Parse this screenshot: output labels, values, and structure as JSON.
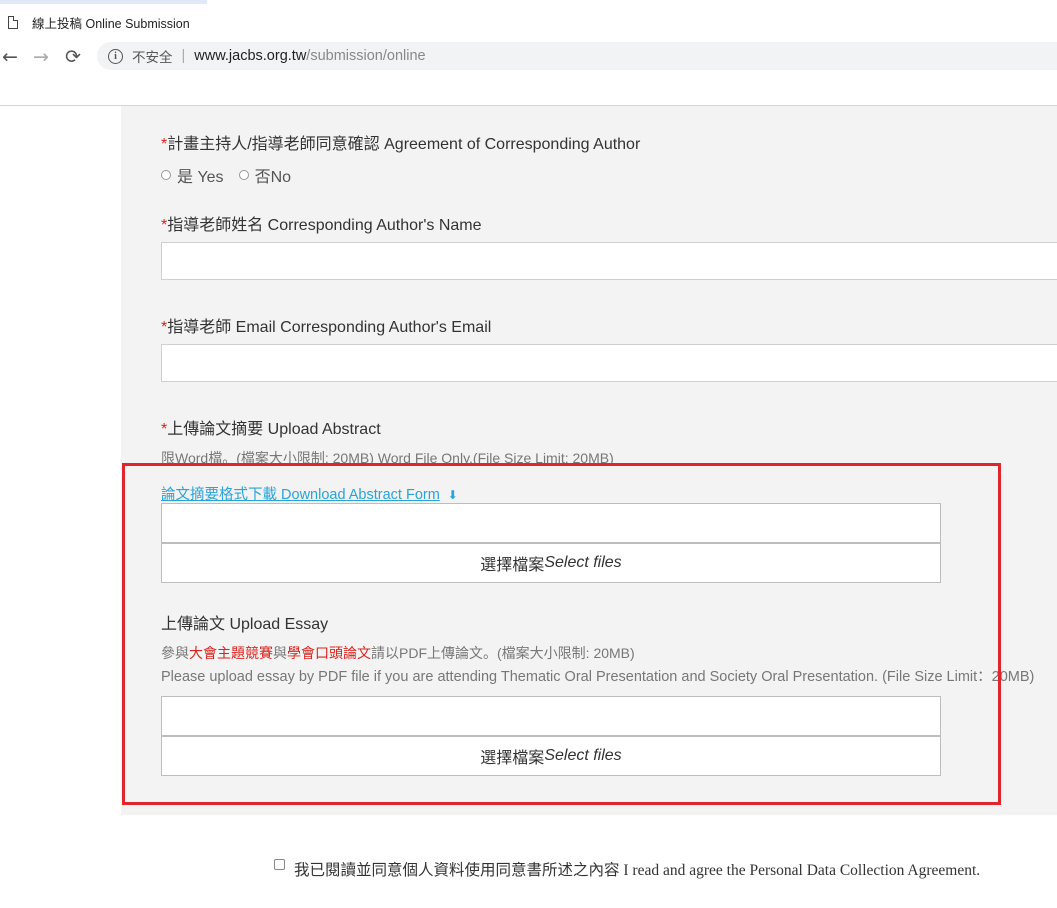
{
  "browser": {
    "tab_title": "線上投稿 Online Submission",
    "nav": {
      "back": "←",
      "forward": "→",
      "reload": "⟳"
    },
    "security_label": "不安全",
    "separator": "|",
    "url_host": "www.jacbs.org.tw",
    "url_path": "/submission/online"
  },
  "form": {
    "required_mark": "*",
    "agreement": {
      "label": "計畫主持人/指導老師同意確認 Agreement of Corresponding Author",
      "options": [
        "是 Yes",
        "否No"
      ]
    },
    "author_name": {
      "label": "指導老師姓名 Corresponding Author's Name",
      "value": ""
    },
    "author_email": {
      "label": "指導老師 Email Corresponding Author's Email",
      "value": ""
    },
    "abstract": {
      "label": "上傳論文摘要 Upload Abstract",
      "hint": "限Word檔。(檔案大小限制: 20MB) Word File Only.(File Size Limit: 20MB)",
      "download_link": "論文摘要格式下載 Download Abstract Form",
      "download_icon": "⬇",
      "select_zh": "選擇檔案",
      "select_en": "Select files"
    },
    "essay": {
      "label": "上傳論文 Upload Essay",
      "hint_part1": "參與",
      "hint_kw1": "大會主題競賽",
      "hint_part2": "與",
      "hint_kw2": "學會口頭論文",
      "hint_part3": "請以PDF上傳論文。(檔案大小限制: 20MB)",
      "hint_en": "Please upload essay by PDF file if you are attending Thematic Oral Presentation and Society Oral Presentation. (File Size Limit：20MB)",
      "select_zh": "選擇檔案",
      "select_en": "Select files"
    },
    "consent": "我已閱讀並同意個人資料使用同意書所述之內容 I read and agree the Personal Data Collection Agreement."
  },
  "colors": {
    "required": "#d9231d",
    "link": "#29a3d8",
    "highlight": "#e0252d",
    "panel": "#f3f3f3"
  }
}
